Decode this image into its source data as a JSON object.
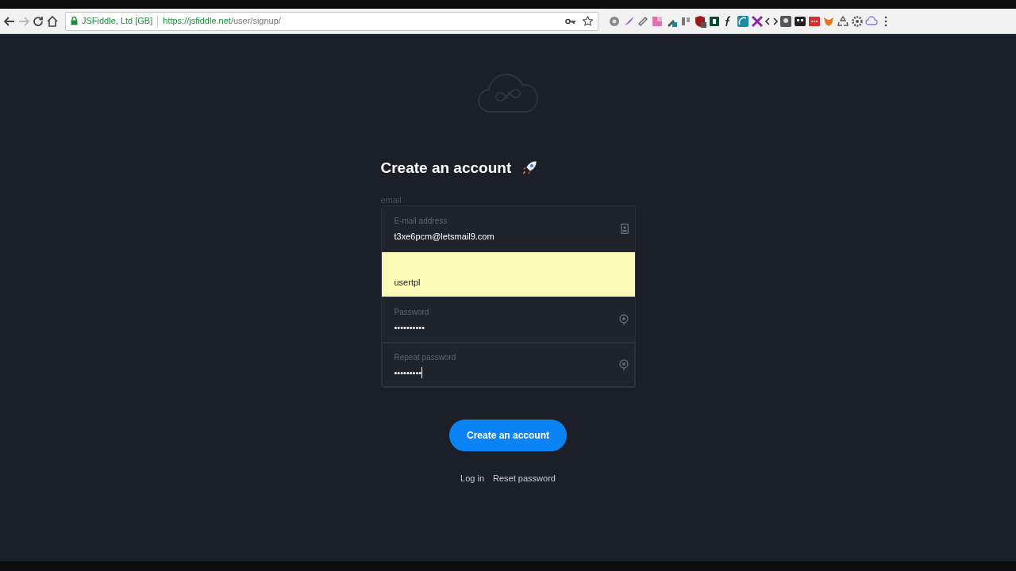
{
  "browser": {
    "site_identity": "JSFiddle, Ltd [GB]",
    "url_host": "https://jsfiddle.net",
    "url_path": "/user/signup/"
  },
  "heading": "Create an account",
  "hidden_label": "email",
  "fields": [
    {
      "label": "E-mail address",
      "value": "t3xe6pcm@letsmail9.com",
      "autofilled": false,
      "focused": false,
      "kind": "email"
    },
    {
      "value": "usertpl",
      "autofilled": true,
      "focused": false,
      "kind": "text"
    },
    {
      "label": "Password",
      "value": "••••••••••",
      "autofilled": false,
      "focused": false,
      "kind": "password"
    },
    {
      "label": "Repeat password",
      "value": "•••••••••",
      "autofilled": false,
      "focused": true,
      "kind": "password"
    }
  ],
  "submit": "Create an account",
  "links": [
    "Log in",
    "Reset password"
  ]
}
